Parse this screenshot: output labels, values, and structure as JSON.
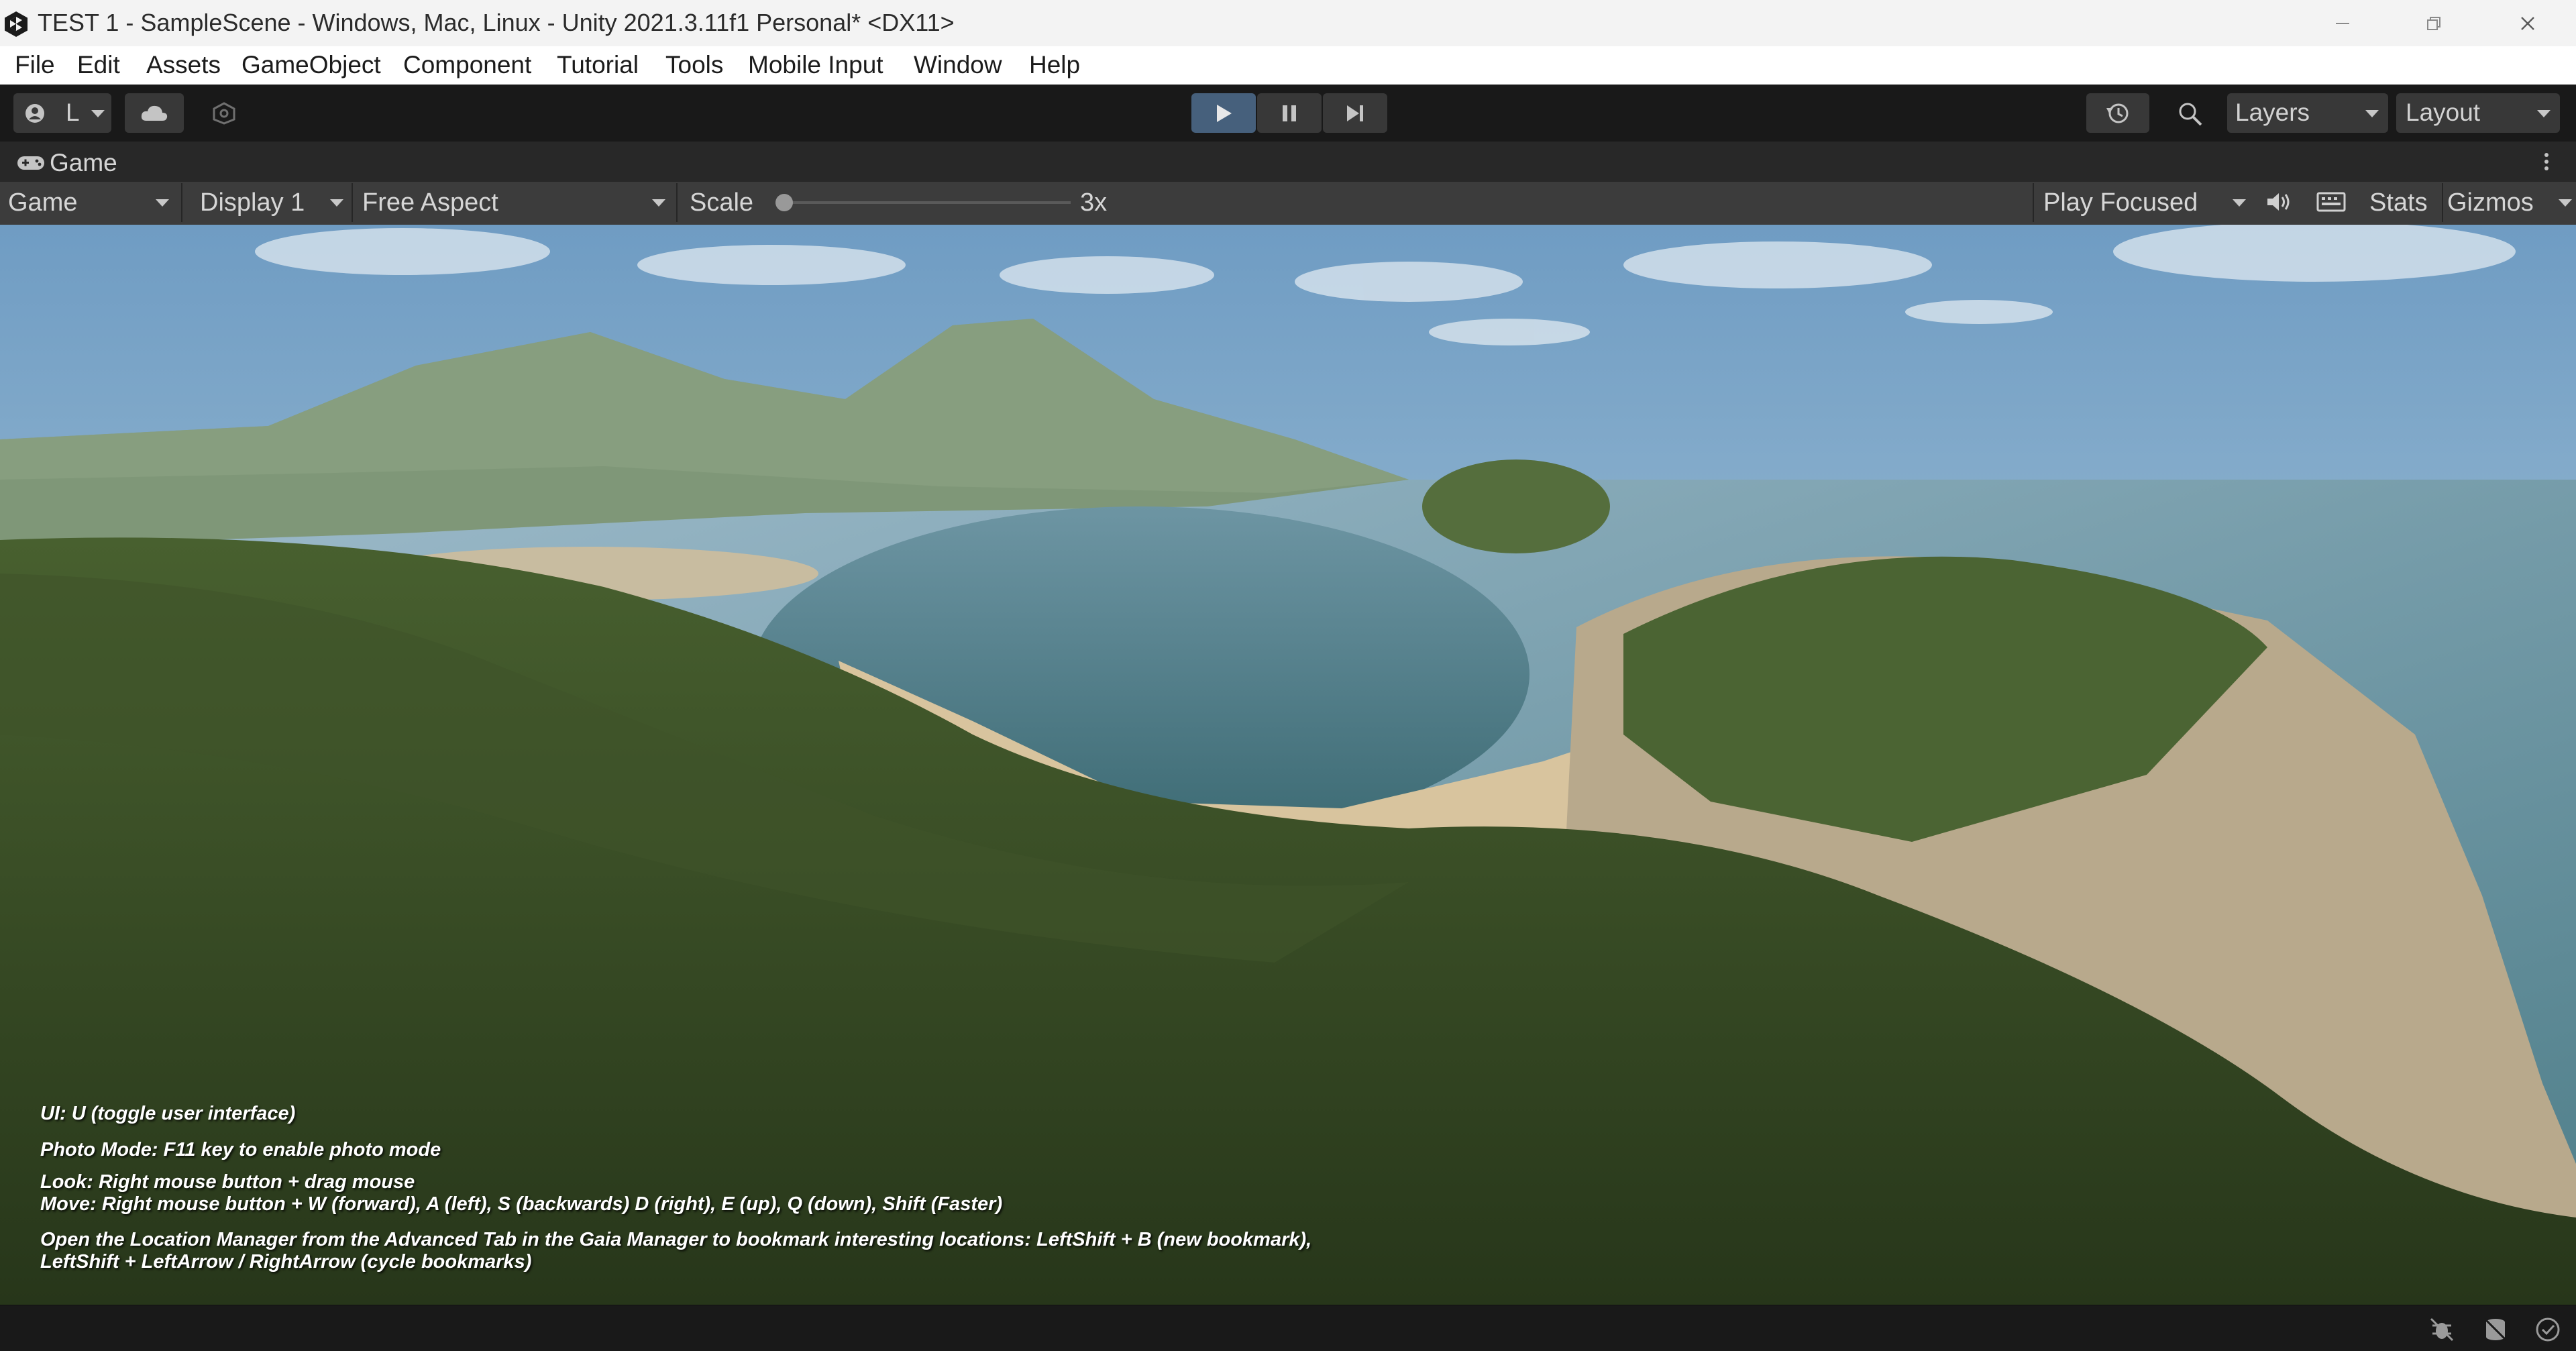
{
  "window": {
    "title": "TEST 1 - SampleScene - Windows, Mac, Linux - Unity 2021.3.11f1 Personal* <DX11>"
  },
  "menu": [
    {
      "key": "file",
      "label": "File"
    },
    {
      "key": "edit",
      "label": "Edit"
    },
    {
      "key": "assets",
      "label": "Assets"
    },
    {
      "key": "gameobject",
      "label": "GameObject"
    },
    {
      "key": "component",
      "label": "Component"
    },
    {
      "key": "tutorial",
      "label": "Tutorial"
    },
    {
      "key": "tools",
      "label": "Tools"
    },
    {
      "key": "mobile-input",
      "label": "Mobile Input"
    },
    {
      "key": "window",
      "label": "Window"
    },
    {
      "key": "help",
      "label": "Help"
    }
  ],
  "toolbar": {
    "account_label": "L",
    "layers_label": "Layers",
    "layout_label": "Layout"
  },
  "game_tab": {
    "label": "Game"
  },
  "game_toolbar": {
    "view_mode": "Game",
    "display": "Display 1",
    "aspect": "Free Aspect",
    "scale_label": "Scale",
    "scale_value": "3x",
    "scale_fraction": 0.0,
    "play_mode": "Play Focused",
    "stats_label": "Stats",
    "gizmos_label": "Gizmos"
  },
  "overlay": {
    "line1": "UI: U (toggle user interface)",
    "line2": "Photo Mode: F11 key to enable photo mode",
    "line3": "Look: Right mouse button + drag mouse",
    "line4": "Move: Right mouse button + W (forward), A (left), S (backwards) D (right), E (up), Q (down), Shift (Faster)",
    "line5": "Open the Location Manager from the Advanced Tab in the Gaia Manager to bookmark interesting locations: LeftShift + B (new bookmark),",
    "line6": "LeftShift + LeftArrow / RightArrow (cycle bookmarks)"
  },
  "colors": {
    "editor_bg": "#191919",
    "toolbar_bg": "#3c3c3c",
    "play_active": "#46607c",
    "menu_bg": "#ffffff",
    "title_bg": "#f3f3f3"
  }
}
